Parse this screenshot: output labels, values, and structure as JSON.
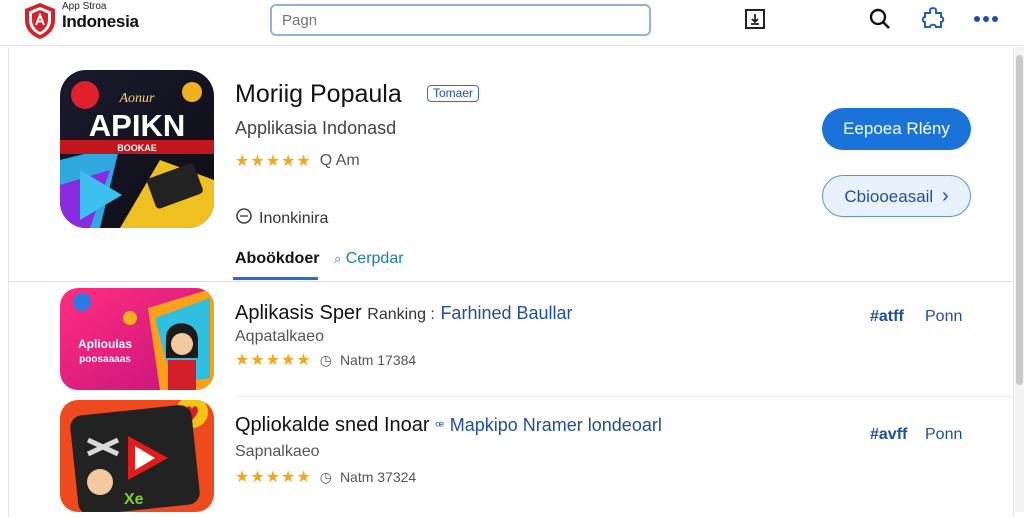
{
  "header": {
    "brand_small": "App Stroa",
    "brand_big": "Indonesia",
    "search_placeholder": "Pagn"
  },
  "hero": {
    "title": "Moriig Popaula",
    "badge": "Tomaer",
    "subtitle": "Applikasia Indonasd",
    "rating_stars": "★★★★★",
    "rating_text": "Q Am",
    "meta_text": "Inonkinira",
    "icon_text": "APIKN",
    "icon_top_text": "Aonur",
    "icon_band_text": "BOOKAE",
    "primary_button": "Eepoea Rlény",
    "secondary_button": "Cbiooeasail",
    "secondary_arrow": "›"
  },
  "tabs": [
    {
      "label": "Aboökdoer"
    },
    {
      "label": "Cerpdar",
      "icon": "search-icon"
    }
  ],
  "list": [
    {
      "title": "Aplikasis Sper",
      "tag": "Ranking :",
      "link": "Farhined Baullar",
      "subtitle": "Aqpatalkaeo",
      "stars": "★★★★★",
      "meta": "Natm 17384",
      "icon_text_1": "Aplioulas",
      "icon_text_2": "poosaaaas",
      "right_tag": "#atff",
      "action": "Ponn"
    },
    {
      "title": "Qpliokalde sned Inoar",
      "tag": "ꟹ",
      "link": "Mapkipo Nramer londeoarl",
      "subtitle": "Sapnalkaeo",
      "stars": "★★★★★",
      "meta": "Natm 37324",
      "icon_text_1": "Xe",
      "right_tag": "#avff",
      "action": "Ponn"
    }
  ],
  "colors": {
    "accent": "#1a73d9",
    "star": "#f2a81a",
    "link": "#1d4f9c"
  }
}
